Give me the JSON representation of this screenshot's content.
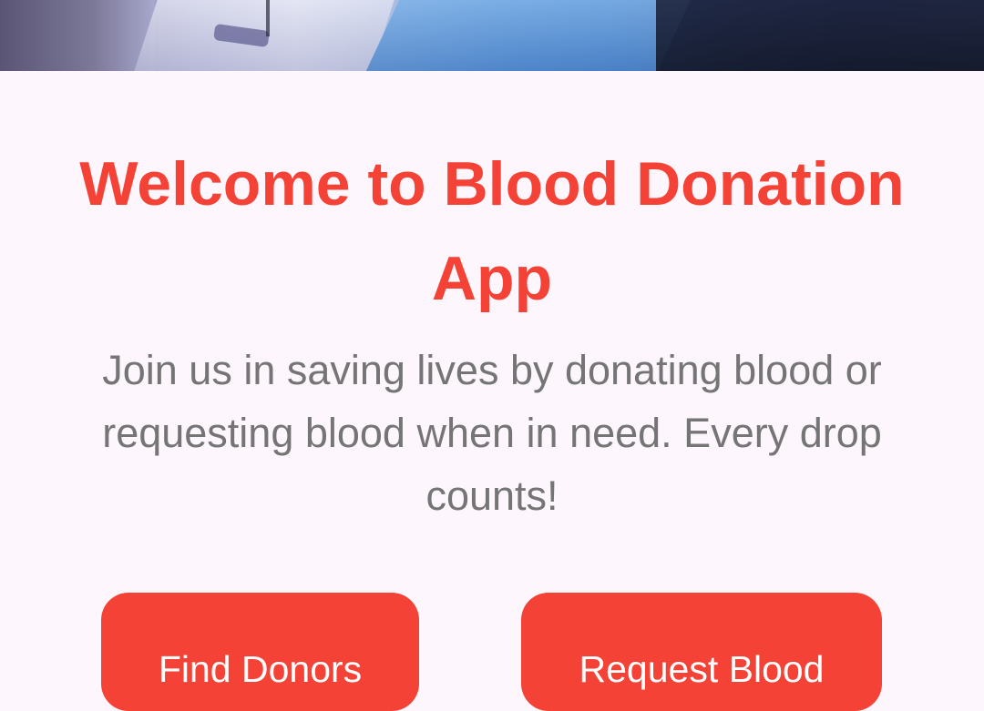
{
  "hero": {
    "image_alt": "blood donation photo"
  },
  "main": {
    "title": "Welcome to Blood Donation App",
    "subtitle": "Join us in saving lives by donating blood or requesting blood when in need. Every drop counts!"
  },
  "actions": {
    "find_donors_label": "Find Donors",
    "request_blood_label": "Request Blood"
  },
  "colors": {
    "accent": "#f44336",
    "background": "#fdf6fc",
    "subtitle_text": "#757575",
    "button_text": "#ffffff"
  }
}
